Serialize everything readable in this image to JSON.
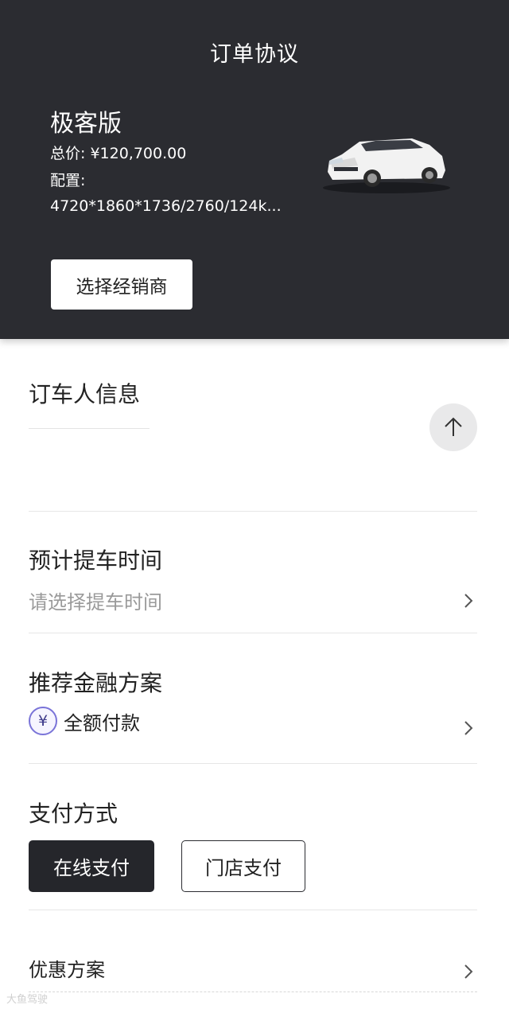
{
  "header": {
    "title": "订单协议",
    "model_name": "极客版",
    "price": "总价: ¥120,700.00",
    "config_label": "配置:",
    "config_value": "4720*1860*1736/2760/124k...",
    "dealer_button": "选择经销商"
  },
  "orderer": {
    "title": "订车人信息",
    "collapse_icon": "arrow-up-icon"
  },
  "pickup": {
    "title": "预计提车时间",
    "placeholder": "请选择提车时间"
  },
  "finance": {
    "title": "推荐金融方案",
    "icon": "yen-icon",
    "icon_glyph": "¥",
    "value": "全额付款"
  },
  "payment": {
    "title": "支付方式",
    "online": "在线支付",
    "store": "门店支付"
  },
  "discount": {
    "title": "优惠方案"
  },
  "watermark": "大鱼驾驶",
  "colors": {
    "header_bg": "#2b2c31",
    "primary_button": "#25262b",
    "yen_icon": "#7a74d8"
  }
}
